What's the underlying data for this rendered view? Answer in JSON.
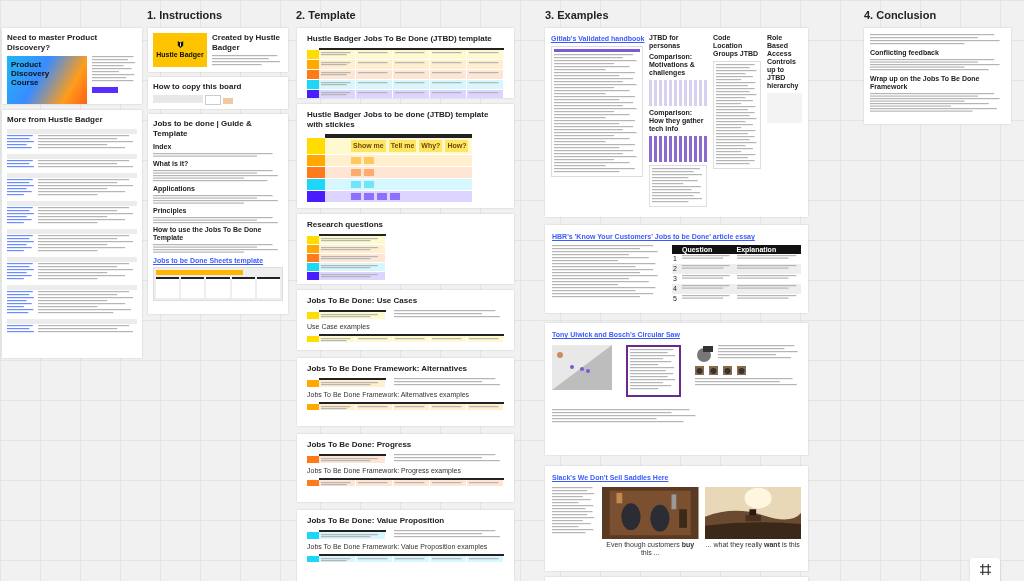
{
  "columns": [
    {
      "title": "1. Instructions"
    },
    {
      "title": "2. Template"
    },
    {
      "title": "3. Examples"
    },
    {
      "title": "4. Conclusion"
    }
  ],
  "instructions": {
    "promo": {
      "title": "Need to master Product Discovery?",
      "course": "Product Discovery Course"
    },
    "more": {
      "title": "More from Hustle Badger"
    },
    "creator": {
      "logo": "Hustle Badger",
      "title": "Created by Hustle Badger"
    },
    "copy": {
      "title": "How to copy this board"
    },
    "guide": {
      "title": "Jobs to be done | Guide & Template",
      "sections": [
        "Index",
        "What is it?",
        "Applications",
        "Principles",
        "How to use the Jobs To Be Done Template"
      ],
      "link": "Jobs to be Done Sheets template"
    }
  },
  "templates": [
    {
      "kind": "table",
      "title": "Hustle Badger Jobs To Be Done (JTBD) template",
      "rows": [
        {
          "color": "#ffdd00"
        },
        {
          "color": "#ffa800"
        },
        {
          "color": "#ff7a1a"
        },
        {
          "color": "#1ed6f5"
        },
        {
          "color": "#4a1dff"
        }
      ]
    },
    {
      "kind": "stickies",
      "title": "Hustle Badger Jobs to be done (JTBD) template with stickies",
      "stickies": [
        "Show me",
        "Tell me",
        "Why?",
        "How?"
      ],
      "rows": [
        {
          "color": "#ffdd00"
        },
        {
          "color": "#ffa800"
        },
        {
          "color": "#ff7a1a"
        },
        {
          "color": "#1ed6f5"
        },
        {
          "color": "#4a1dff"
        }
      ]
    },
    {
      "kind": "mini",
      "title": "Research questions",
      "rows": [
        {
          "color": "#ffdd00"
        },
        {
          "color": "#ffa800"
        },
        {
          "color": "#ff7a1a"
        },
        {
          "color": "#1ed6f5"
        },
        {
          "color": "#4a1dff"
        }
      ]
    },
    {
      "kind": "split",
      "title": "Jobs To Be Done: Use Cases",
      "subtitle": "Use Case examples",
      "rows": [
        {
          "color": "#ffdd00"
        }
      ]
    },
    {
      "kind": "split",
      "title": "Jobs To Be Done Framework: Alternatives",
      "subtitle": "Jobs To Be Done Framework: Alternatives examples",
      "rows": [
        {
          "color": "#ffa800"
        }
      ]
    },
    {
      "kind": "split",
      "title": "Jobs To Be Done: Progress",
      "subtitle": "Jobs To Be Done Framework: Progress examples",
      "rows": [
        {
          "color": "#ff7a1a"
        }
      ]
    },
    {
      "kind": "split",
      "title": "Jobs To Be Done: Value Proposition",
      "subtitle": "Jobs To Be Done Framework: Value Proposition examples",
      "rows": [
        {
          "color": "#1ed6f5"
        }
      ]
    }
  ],
  "examples": {
    "gitlab": {
      "link": "Gitlab's Validated handbook",
      "personas": "JTBD for personas",
      "comparison_1": "Comparison: Motivations & challenges",
      "comparison_2": "Comparison: How they gather tech info",
      "code": "Code Location Groups JTBD",
      "rbac": "Role Based Access Controls up to JTBD hierarchy"
    },
    "hbr": {
      "link": "HBR's 'Know Your Customers' Jobs to be Done' article essay",
      "columns": [
        "Question",
        "Explanation"
      ],
      "numbers": [
        "1",
        "2",
        "3",
        "4",
        "5"
      ]
    },
    "saw": {
      "link": "Tony Ulwick and Bosch's Circular Saw"
    },
    "saddles": {
      "link": "Slack's We Don't Sell Saddles Here",
      "captions": [
        "Even though customers **buy** this ...",
        "... what they really **want** is this"
      ]
    }
  },
  "conclusion": {
    "sections": [
      "Conflicting feedback",
      "Wrap up on the Jobs To Be Done Framework"
    ]
  }
}
